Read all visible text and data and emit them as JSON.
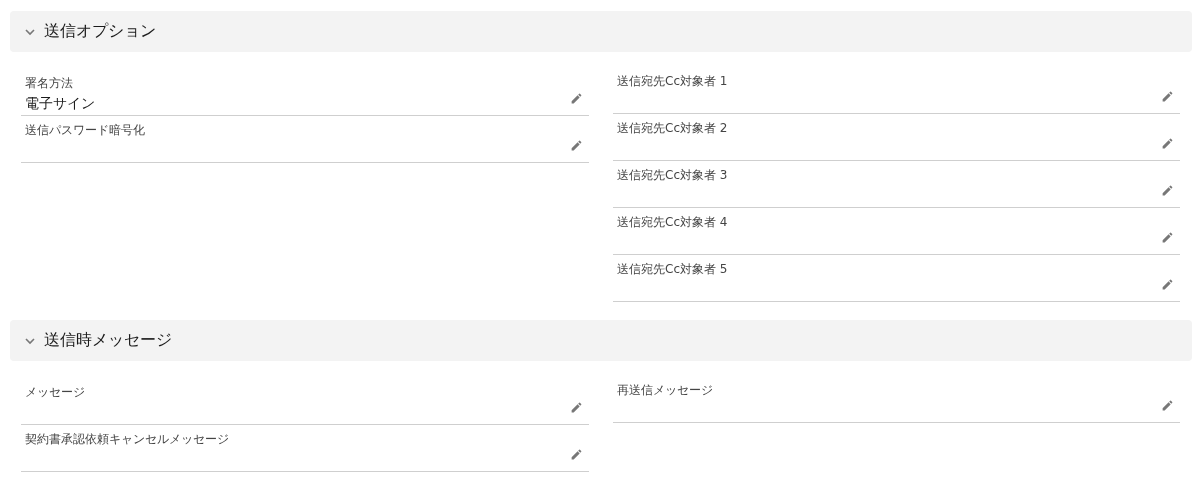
{
  "sections": [
    {
      "title": "送信オプション",
      "expanded": true,
      "columns": [
        [
          {
            "label": "署名方法",
            "value": "電子サイン"
          },
          {
            "label": "送信パスワード暗号化"
          }
        ],
        [
          {
            "label": "送信宛先Cc対象者 1"
          },
          {
            "label": "送信宛先Cc対象者 2"
          },
          {
            "label": "送信宛先Cc対象者 3"
          },
          {
            "label": "送信宛先Cc対象者 4"
          },
          {
            "label": "送信宛先Cc対象者 5"
          }
        ]
      ]
    },
    {
      "title": "送信時メッセージ",
      "expanded": true,
      "columns": [
        [
          {
            "label": "メッセージ"
          },
          {
            "label": "契約書承認依頼キャンセルメッセージ"
          }
        ],
        [
          {
            "label": "再送信メッセージ"
          }
        ]
      ]
    }
  ]
}
